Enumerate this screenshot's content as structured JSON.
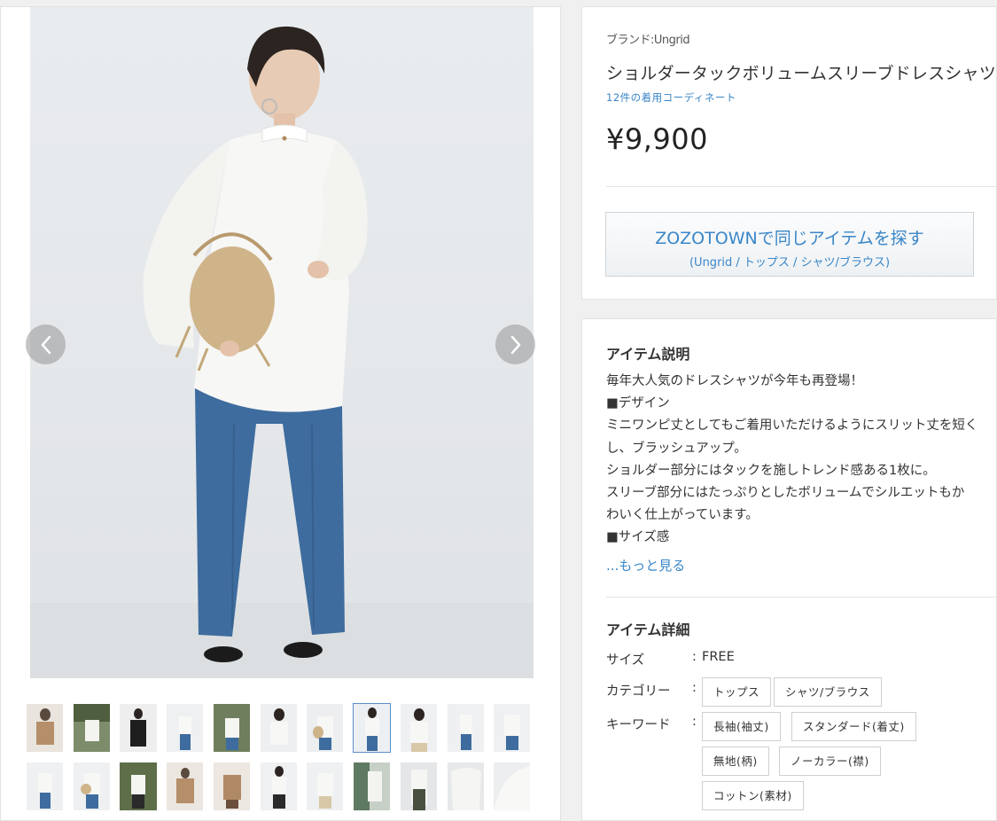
{
  "gallery": {
    "prev_icon": "chevron-left-icon",
    "next_icon": "chevron-right-icon",
    "thumbnail_selected_index": 7
  },
  "product": {
    "brand": "ブランド:Ungrid",
    "title": "ショルダータックボリュームスリーブドレスシャツ",
    "coordinate_link": "12件の着用コーディネート",
    "price": "¥9,900"
  },
  "zozo_button": {
    "main": "ZOZOTOWNで同じアイテムを探す",
    "sub": "(Ungrid / トップス / シャツ/ブラウス)"
  },
  "description": {
    "heading": "アイテム説明",
    "lines": [
      "毎年大人気のドレスシャツが今年も再登場！",
      "■デザイン",
      "ミニワンピ丈としてもご着用いただけるようにスリット丈を短く",
      "し、ブラッシュアップ。",
      "ショルダー部分にはタックを施しトレンド感ある1枚に。",
      "スリーブ部分にはたっぷりとしたボリュームでシルエットもか",
      "わいく仕上がっています。",
      "■サイズ感"
    ],
    "more_link": "...もっと見る"
  },
  "details": {
    "heading": "アイテム詳細",
    "size_label": "サイズ",
    "size_value": "FREE",
    "category_label": "カテゴリー",
    "categories": [
      "トップス",
      "シャツ/ブラウス"
    ],
    "keyword_label": "キーワード",
    "keywords": [
      "長袖(袖丈)",
      "スタンダード(着丈)",
      "無地(柄)",
      "ノーカラー(襟)",
      "コットン(素材)"
    ],
    "colon": ":"
  }
}
